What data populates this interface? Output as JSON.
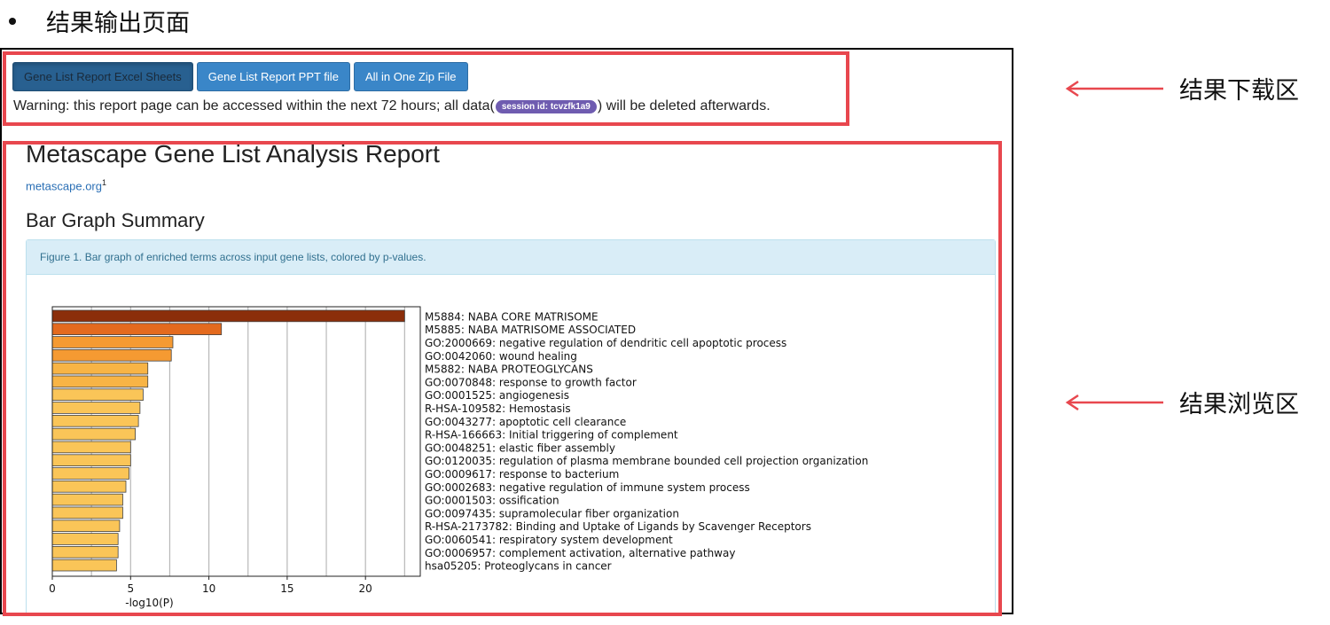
{
  "heading": "结果输出页面",
  "toolbar": {
    "buttons": [
      {
        "label": "Gene List Report Excel Sheets"
      },
      {
        "label": "Gene List Report PPT file"
      },
      {
        "label": "All in One Zip File"
      }
    ]
  },
  "warning": {
    "prefix": "Warning: this report page can be accessed within the next 72 hours; all data(",
    "session": "session id: tcvzfk1a9",
    "suffix": ") will be deleted afterwards."
  },
  "report": {
    "title": "Metascape Gene List Analysis Report",
    "site": "metascape.org",
    "site_sup": "1",
    "section": "Bar Graph Summary",
    "figure_caption": "Figure 1. Bar graph of enriched terms across input gene lists, colored by p-values."
  },
  "annotations": {
    "download_area": "结果下载区",
    "browse_area": "结果浏览区"
  },
  "colors": {
    "highlight": "#e8474e",
    "button": "#3a86c8",
    "badge": "#6f5cb0"
  },
  "chart_data": {
    "type": "bar",
    "orientation": "horizontal",
    "categories": [
      "M5884: NABA CORE MATRISOME",
      "M5885: NABA MATRISOME ASSOCIATED",
      "GO:2000669: negative regulation of dendritic cell apoptotic process",
      "GO:0042060: wound healing",
      "M5882: NABA PROTEOGLYCANS",
      "GO:0070848: response to growth factor",
      "GO:0001525: angiogenesis",
      "R-HSA-109582: Hemostasis",
      "GO:0043277: apoptotic cell clearance",
      "R-HSA-166663: Initial triggering of complement",
      "GO:0048251: elastic fiber assembly",
      "GO:0120035: regulation of plasma membrane bounded cell projection organization",
      "GO:0009617: response to bacterium",
      "GO:0002683: negative regulation of immune system process",
      "GO:0001503: ossification",
      "GO:0097435: supramolecular fiber organization",
      "R-HSA-2173782: Binding and Uptake of Ligands by Scavenger Receptors",
      "GO:0060541: respiratory system development",
      "GO:0006957: complement activation, alternative pathway",
      "hsa05205: Proteoglycans in cancer"
    ],
    "values": [
      22.5,
      10.8,
      7.7,
      7.6,
      6.1,
      6.1,
      5.8,
      5.6,
      5.5,
      5.3,
      5.0,
      5.0,
      4.9,
      4.7,
      4.5,
      4.5,
      4.3,
      4.2,
      4.2,
      4.1
    ],
    "xlabel": "-log10(P)",
    "xticks": [
      0,
      5,
      10,
      15,
      20
    ],
    "xlim": [
      0,
      23.5
    ],
    "grid": "vertical",
    "colors": [
      "#8b2e0a",
      "#e46a1e",
      "#f59a32",
      "#f59a32",
      "#f8b445",
      "#f8b445",
      "#fac558",
      "#fac558",
      "#fac558",
      "#fac558",
      "#fac558",
      "#fac558",
      "#fac558",
      "#fac558",
      "#fac558",
      "#fac558",
      "#fac558",
      "#fac558",
      "#fac558",
      "#fac558"
    ]
  }
}
